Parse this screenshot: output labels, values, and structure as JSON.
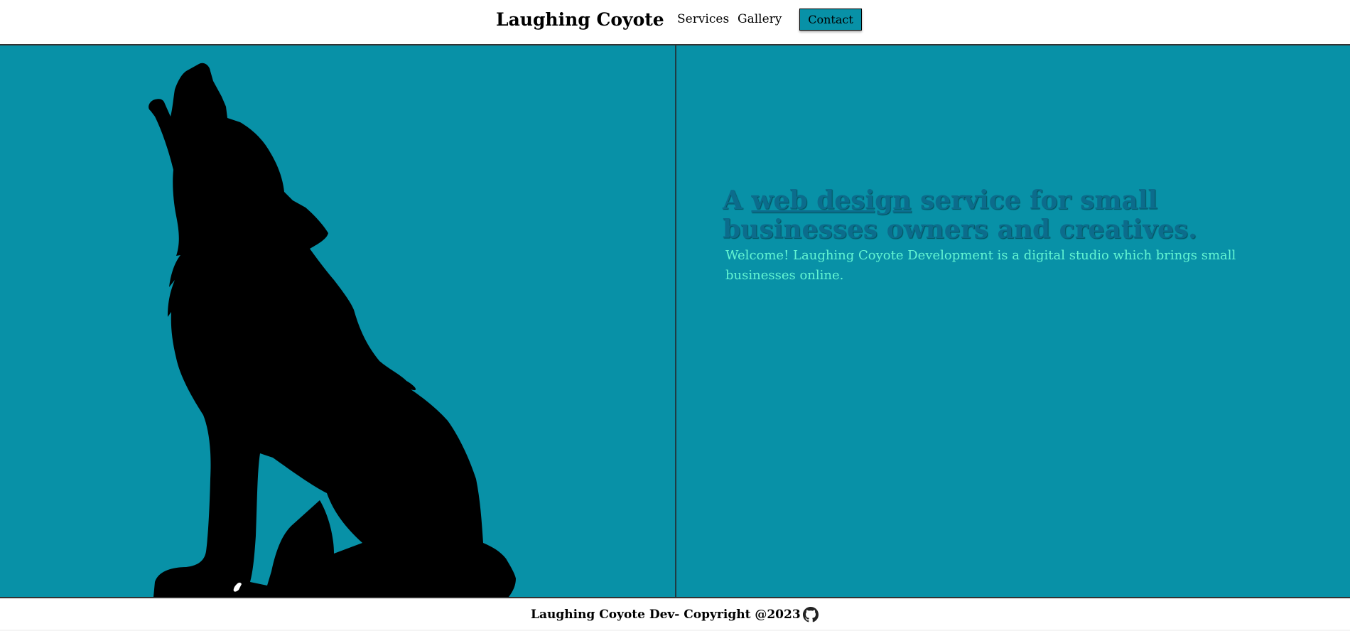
{
  "header": {
    "brand": "Laughing Coyote",
    "nav": [
      {
        "label": "Services"
      },
      {
        "label": "Gallery"
      }
    ],
    "contact_label": "Contact"
  },
  "hero": {
    "headline_prefix": "A ",
    "headline_link": "web design",
    "headline_suffix": " service for small businesses owners and creatives.",
    "welcome": "Welcome! Laughing Coyote Development is a digital studio which brings small businesses online.",
    "illustration": "howling-coyote-silhouette"
  },
  "footer": {
    "copyright": "Laughing Coyote Dev- Copyright @2023",
    "github_icon": "github-icon"
  },
  "colors": {
    "hero_bg": "#0891a7",
    "headline": "#0c6c8c",
    "welcome_text": "#63f5d2",
    "silhouette": "#000000"
  }
}
